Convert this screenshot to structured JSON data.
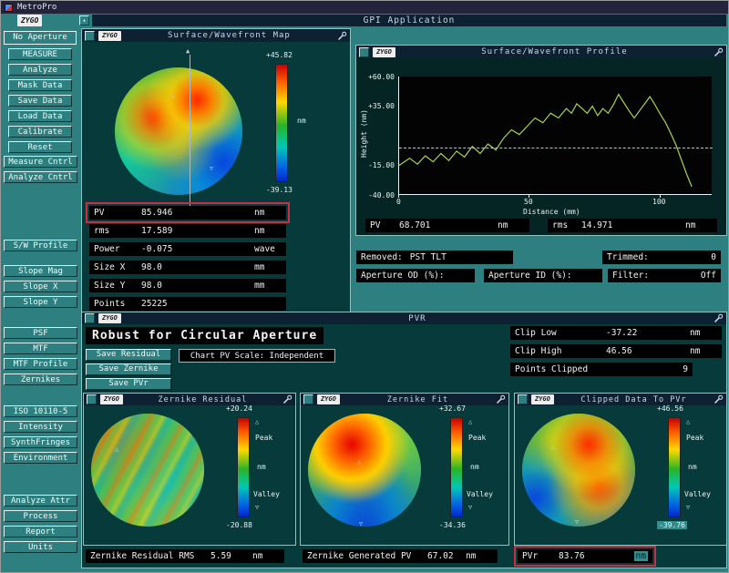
{
  "os": {
    "title": "MetroPro"
  },
  "app": {
    "title": "GPI Application",
    "logo": "ZYGO"
  },
  "colors": {
    "background": "#2e7f7f",
    "window_bg": "#073a3a",
    "titlebar": "#0d2133",
    "field_bg": "#000000",
    "highlight_red": "#c83040",
    "plot_line": "#a8d44a"
  },
  "sidebar": {
    "aperture": "No Aperture",
    "buttons": [
      "MEASURE",
      "Analyze",
      "Mask Data",
      "Save Data",
      "Load Data",
      "Calibrate",
      "Reset",
      "Measure Cntrl",
      "Analyze Cntrl",
      "S/W Profile",
      "Slope Mag",
      "Slope X",
      "Slope Y",
      "PSF",
      "MTF",
      "MTF Profile",
      "Zernikes",
      "ISO 10110-5",
      "Intensity",
      "SynthFringes",
      "Environment",
      "Analyze Attr",
      "Process",
      "Report",
      "Units"
    ]
  },
  "map_window": {
    "title": "Surface/Wavefront Map",
    "colorbar": {
      "max": "+45.82",
      "unit": "nm",
      "min": "-39.13"
    },
    "stats": [
      {
        "label": "PV",
        "value": "85.946",
        "unit": "nm"
      },
      {
        "label": "rms",
        "value": "17.589",
        "unit": "nm"
      },
      {
        "label": "Power",
        "value": "-0.075",
        "unit": "wave"
      },
      {
        "label": "Size X",
        "value": "98.0",
        "unit": "mm"
      },
      {
        "label": "Size Y",
        "value": "98.0",
        "unit": "mm"
      },
      {
        "label": "Points",
        "value": "25225",
        "unit": ""
      }
    ]
  },
  "profile_window": {
    "title": "Surface/Wavefront Profile",
    "ylabel": "Height (nm)",
    "xlabel": "Distance (mm)",
    "yticks": [
      "+60.00",
      "+35.00",
      "-15.00",
      "-40.00"
    ],
    "xticks": [
      "0",
      "50",
      "100"
    ],
    "xrange": [
      0,
      120
    ],
    "yrange": [
      -40,
      60
    ],
    "points": [
      [
        0,
        -15
      ],
      [
        4,
        -9
      ],
      [
        7,
        -14
      ],
      [
        10,
        -7
      ],
      [
        13,
        -12
      ],
      [
        16,
        -5
      ],
      [
        19,
        -11
      ],
      [
        22,
        -3
      ],
      [
        25,
        -8
      ],
      [
        28,
        1
      ],
      [
        31,
        -5
      ],
      [
        34,
        3
      ],
      [
        37,
        -2
      ],
      [
        40,
        8
      ],
      [
        43,
        15
      ],
      [
        46,
        11
      ],
      [
        49,
        18
      ],
      [
        52,
        25
      ],
      [
        55,
        21
      ],
      [
        58,
        29
      ],
      [
        61,
        25
      ],
      [
        64,
        33
      ],
      [
        66,
        29
      ],
      [
        68,
        37
      ],
      [
        70,
        33
      ],
      [
        72,
        29
      ],
      [
        74,
        35
      ],
      [
        76,
        27
      ],
      [
        78,
        33
      ],
      [
        80,
        29
      ],
      [
        82,
        36
      ],
      [
        84,
        45
      ],
      [
        86,
        38
      ],
      [
        88,
        31
      ],
      [
        90,
        25
      ],
      [
        92,
        31
      ],
      [
        94,
        37
      ],
      [
        96,
        43
      ],
      [
        98,
        36
      ],
      [
        100,
        28
      ],
      [
        102,
        21
      ],
      [
        104,
        12
      ],
      [
        106,
        2
      ],
      [
        108,
        -10
      ],
      [
        110,
        -22
      ],
      [
        112,
        -33
      ]
    ],
    "stats": [
      {
        "label": "PV",
        "value": "68.701",
        "unit": "nm"
      },
      {
        "label": "rms",
        "value": "14.971",
        "unit": "nm"
      }
    ]
  },
  "info": {
    "removed_label": "Removed:",
    "removed_value": "PST TLT",
    "trimmed_label": "Trimmed:",
    "trimmed_value": "0",
    "aperture_od_label": "Aperture OD (%):",
    "aperture_od_value": "",
    "aperture_id_label": "Aperture ID (%):",
    "aperture_id_value": "",
    "filter_label": "Filter:",
    "filter_value": "Off"
  },
  "pvr_window": {
    "title": "PVR",
    "heading": "Robust for Circular Aperture",
    "buttons": [
      "Save Residual",
      "Save Zernike",
      "Save PVr"
    ],
    "chart_scale": "Chart PV Scale: Independent",
    "fields": [
      {
        "label": "Clip Low",
        "value": "-37.22",
        "unit": "nm"
      },
      {
        "label": "Clip High",
        "value": "46.56",
        "unit": "nm"
      },
      {
        "label": "Points Clipped",
        "value": "9",
        "unit": ""
      }
    ]
  },
  "subwindows": [
    {
      "title": "Zernike Residual",
      "colorbar": {
        "max": "+20.24",
        "peak": "Peak",
        "unit": "nm",
        "valley": "Valley",
        "min": "-20.88"
      }
    },
    {
      "title": "Zernike Fit",
      "colorbar": {
        "max": "+32.67",
        "peak": "Peak",
        "unit": "nm",
        "valley": "Valley",
        "min": "-34.36"
      }
    },
    {
      "title": "Clipped Data To PVr",
      "colorbar": {
        "max": "+46.56",
        "peak": "Peak",
        "unit": "nm",
        "valley": "Valley",
        "min": "-39.76"
      }
    }
  ],
  "bottom_stats": [
    {
      "label": "Zernike Residual RMS",
      "value": "5.59",
      "unit": "nm"
    },
    {
      "label": "Zernike Generated PV",
      "value": "67.02",
      "unit": "nm"
    },
    {
      "label": "PVr",
      "value": "83.76",
      "unit": "nm"
    }
  ]
}
